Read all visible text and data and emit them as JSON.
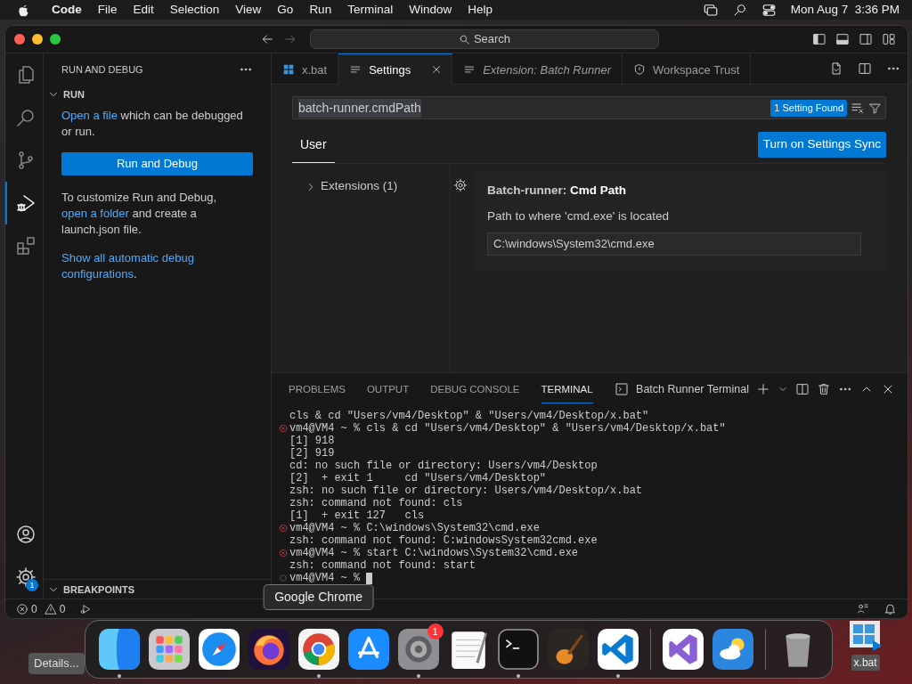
{
  "menu_bar": {
    "app": "Code",
    "menus": [
      "File",
      "Edit",
      "Selection",
      "View",
      "Go",
      "Run",
      "Terminal",
      "Window",
      "Help"
    ],
    "clock": "Mon Aug 7  3:36 PM"
  },
  "title_bar": {
    "search": "Search"
  },
  "activity_bar": {
    "items": [
      {
        "kind": "explorer",
        "selected": false
      },
      {
        "kind": "search",
        "selected": false
      },
      {
        "kind": "scm",
        "selected": false
      },
      {
        "kind": "debug",
        "selected": true
      },
      {
        "kind": "extensions",
        "selected": false
      }
    ],
    "bottom": [
      {
        "kind": "accounts"
      },
      {
        "kind": "manage",
        "badge": "1"
      }
    ]
  },
  "sidebar": {
    "title": "RUN AND DEBUG",
    "section": "RUN",
    "paragraphs": [
      {
        "parts": [
          {
            "text": "Open a file",
            "link": true
          },
          {
            "text": " which can be debugged or run.",
            "link": false
          }
        ]
      },
      {
        "parts": [
          {
            "text": "To customize Run and Debug, ",
            "link": false
          },
          {
            "text": "open a folder",
            "link": true
          },
          {
            "text": " and create a launch.json file.",
            "link": false
          }
        ]
      }
    ],
    "button": "Run and Debug",
    "configurations_link": {
      "link": "Show all automatic debug configurations",
      "tail": "."
    },
    "collapsed_section": "BREAKPOINTS"
  },
  "tabs": [
    {
      "label": "x.bat",
      "kind": "file",
      "selected": false,
      "preview": false
    },
    {
      "label": "Settings",
      "kind": "settings",
      "selected": true,
      "preview": false
    },
    {
      "label": "Extension: Batch Runner",
      "kind": "extension",
      "selected": false,
      "preview": true
    },
    {
      "label": "Workspace Trust",
      "kind": "trust",
      "selected": false,
      "preview": false
    }
  ],
  "settings": {
    "search": "batch-runner.cmdPath",
    "found": "1 Setting Found",
    "scopes": [
      {
        "label": "User",
        "selected": true
      }
    ],
    "sync_button": "Turn on Settings Sync",
    "toc": [
      {
        "label": "Extensions (1)",
        "expanded": false
      }
    ],
    "setting": {
      "title": "Batch-runner: **Cmd Path**",
      "description": "Path to where 'cmd.exe' is located",
      "value": "C:\\windows\\System32\\cmd.exe"
    }
  },
  "panel": {
    "tabs": [
      {
        "label": "PROBLEMS",
        "selected": false
      },
      {
        "label": "OUTPUT",
        "selected": false
      },
      {
        "label": "DEBUG CONSOLE",
        "selected": false
      },
      {
        "label": "TERMINAL",
        "selected": true
      }
    ],
    "terminal_name": "Batch Runner Terminal",
    "lines": [
      {
        "kind": "output",
        "text": "cls & cd \"Users/vm4/Desktop\" & \"Users/vm4/Desktop/x.bat\""
      },
      {
        "kind": "error-prompt",
        "text": "vm4@VM4 ~ % cls & cd \"Users/vm4/Desktop\" & \"Users/vm4/Desktop/x.bat\""
      },
      {
        "kind": "output",
        "text": "[1] 918"
      },
      {
        "kind": "output",
        "text": "[2] 919"
      },
      {
        "kind": "output",
        "text": "cd: no such file or directory: Users/vm4/Desktop"
      },
      {
        "kind": "output",
        "text": "[2]  + exit 1     cd \"Users/vm4/Desktop\""
      },
      {
        "kind": "output",
        "text": "zsh: no such file or directory: Users/vm4/Desktop/x.bat"
      },
      {
        "kind": "output",
        "text": "zsh: command not found: cls"
      },
      {
        "kind": "output",
        "text": "[1]  + exit 127   cls"
      },
      {
        "kind": "error-prompt",
        "text": "vm4@VM4 ~ % C:\\windows\\System32\\cmd.exe"
      },
      {
        "kind": "output",
        "text": "zsh: command not found: C:windowsSystem32cmd.exe"
      },
      {
        "kind": "error-prompt",
        "text": "vm4@VM4 ~ % start C:\\windows\\System32\\cmd.exe"
      },
      {
        "kind": "output",
        "text": "zsh: command not found: start"
      },
      {
        "kind": "prompt",
        "text": "vm4@VM4 ~ %",
        "cursor": true
      }
    ]
  },
  "status_bar": {
    "errors": "0",
    "warnings": "0"
  },
  "dock": {
    "groups": [
      {
        "items": [
          {
            "kind": "finder",
            "running": true
          },
          {
            "kind": "launchpad",
            "running": false
          },
          {
            "kind": "safari",
            "running": false
          },
          {
            "kind": "firefox",
            "running": false
          },
          {
            "kind": "chrome",
            "running": true,
            "tooltip": "Google Chrome"
          },
          {
            "kind": "app-store",
            "running": false
          },
          {
            "kind": "settings",
            "running": true,
            "badge": "1"
          },
          {
            "kind": "textedit",
            "running": false
          },
          {
            "kind": "terminal",
            "running": true
          },
          {
            "kind": "garageband",
            "running": false
          },
          {
            "kind": "vscode",
            "running": true
          }
        ]
      },
      {
        "items": [
          {
            "kind": "visual-studio",
            "running": false
          },
          {
            "kind": "weather",
            "running": false
          }
        ]
      },
      {
        "items": [
          {
            "kind": "trash",
            "running": false
          }
        ]
      }
    ]
  },
  "desktop": {
    "details_button": "Details...",
    "file": "x.bat"
  }
}
